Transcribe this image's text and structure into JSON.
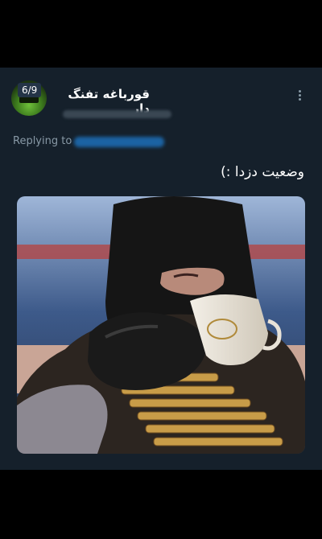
{
  "tweet": {
    "counter": "6/9",
    "display_name": "قورباغه تفنگ دار",
    "replying_label": "Replying to",
    "text": "وضعیت دزدا :)",
    "media_icon": "masked-man-drinking-tea"
  },
  "colors": {
    "background": "#15202b",
    "screen_outside": "#000000",
    "secondary_text": "#8899a6",
    "link": "#1d9bf0"
  }
}
